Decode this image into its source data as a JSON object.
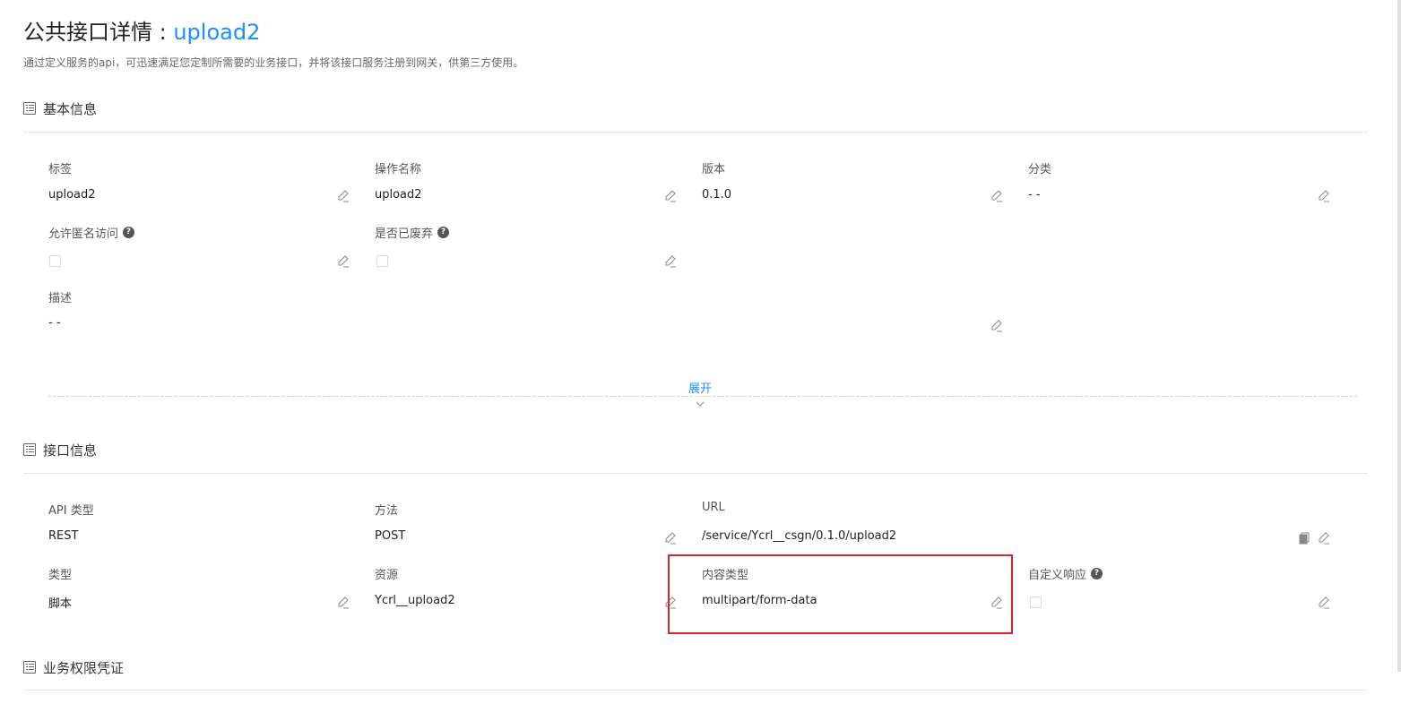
{
  "header": {
    "title_prefix": "公共接口详情 : ",
    "title_name": "upload2",
    "subtitle": "通过定义服务的api，可迅速满足您定制所需要的业务接口，并将该接口服务注册到网关，供第三方使用。"
  },
  "basic_info": {
    "section_title": "基本信息",
    "fields": {
      "tag": {
        "label": "标签",
        "value": "upload2"
      },
      "operation_name": {
        "label": "操作名称",
        "value": "upload2"
      },
      "version": {
        "label": "版本",
        "value": "0.1.0"
      },
      "category": {
        "label": "分类",
        "value": "- -"
      },
      "allow_anonymous": {
        "label": "允许匿名访问",
        "checked": false
      },
      "deprecated": {
        "label": "是否已废弃",
        "checked": false
      },
      "description": {
        "label": "描述",
        "value": "- -"
      }
    },
    "expand_label": "展开"
  },
  "interface_info": {
    "section_title": "接口信息",
    "fields": {
      "api_type": {
        "label": "API 类型",
        "value": "REST"
      },
      "method": {
        "label": "方法",
        "value": "POST"
      },
      "url": {
        "label": "URL",
        "value": "/service/Ycrl__csgn/0.1.0/upload2"
      },
      "type": {
        "label": "类型",
        "value": "脚本"
      },
      "resource": {
        "label": "资源",
        "value": "Ycrl__upload2"
      },
      "content_type": {
        "label": "内容类型",
        "value": "multipart/form-data"
      },
      "custom_response": {
        "label": "自定义响应",
        "checked": false
      }
    }
  },
  "credentials": {
    "section_title": "业务权限凭证"
  },
  "icons": {
    "edit": "pencil-edit-icon",
    "copy": "copy-icon",
    "help": "question-circle-icon",
    "section": "list-icon",
    "expand": "chevron-down-icon"
  },
  "colors": {
    "accent": "#1890ff",
    "highlight": "#d9232e"
  }
}
